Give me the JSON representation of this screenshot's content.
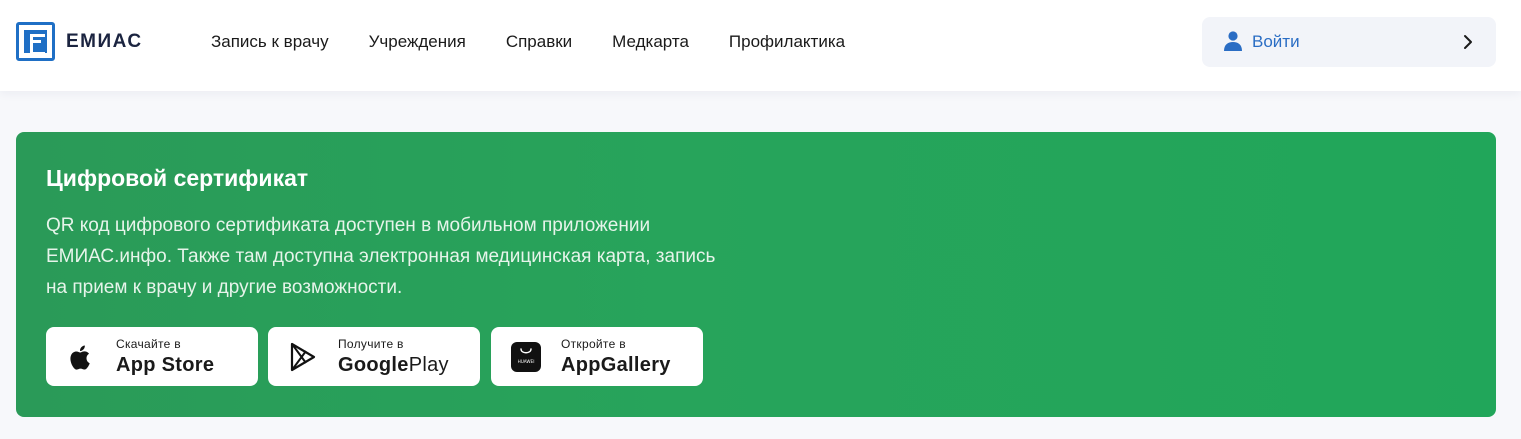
{
  "brand": {
    "name": "ЕМИАС"
  },
  "nav": {
    "items": [
      "Запись к врачу",
      "Учреждения",
      "Справки",
      "Медкарта",
      "Профилактика"
    ]
  },
  "login": {
    "label": "Войти",
    "icon": "user-icon"
  },
  "banner": {
    "title": "Цифровой сертификат",
    "text": "QR код цифрового сертификата доступен в мобильном приложении ЕМИАС.инфо. Также там доступна электронная медицинская карта, запись на прием к врачу и другие возможности.",
    "background": "#27a45b",
    "stores": [
      {
        "small": "Скачайте в",
        "big": "App Store",
        "icon": "apple-icon"
      },
      {
        "small": "Получите в",
        "big_bold": "Google",
        "big_light": "Play",
        "icon": "google-play-icon"
      },
      {
        "small": "Откройте в",
        "big": "AppGallery",
        "icon": "huawei-appgallery-icon",
        "icon_text": "HUAWEI"
      }
    ]
  },
  "colors": {
    "accent": "#2a6dc4",
    "brand_blue": "#1f6fc5",
    "banner_green": "#27a45b"
  }
}
